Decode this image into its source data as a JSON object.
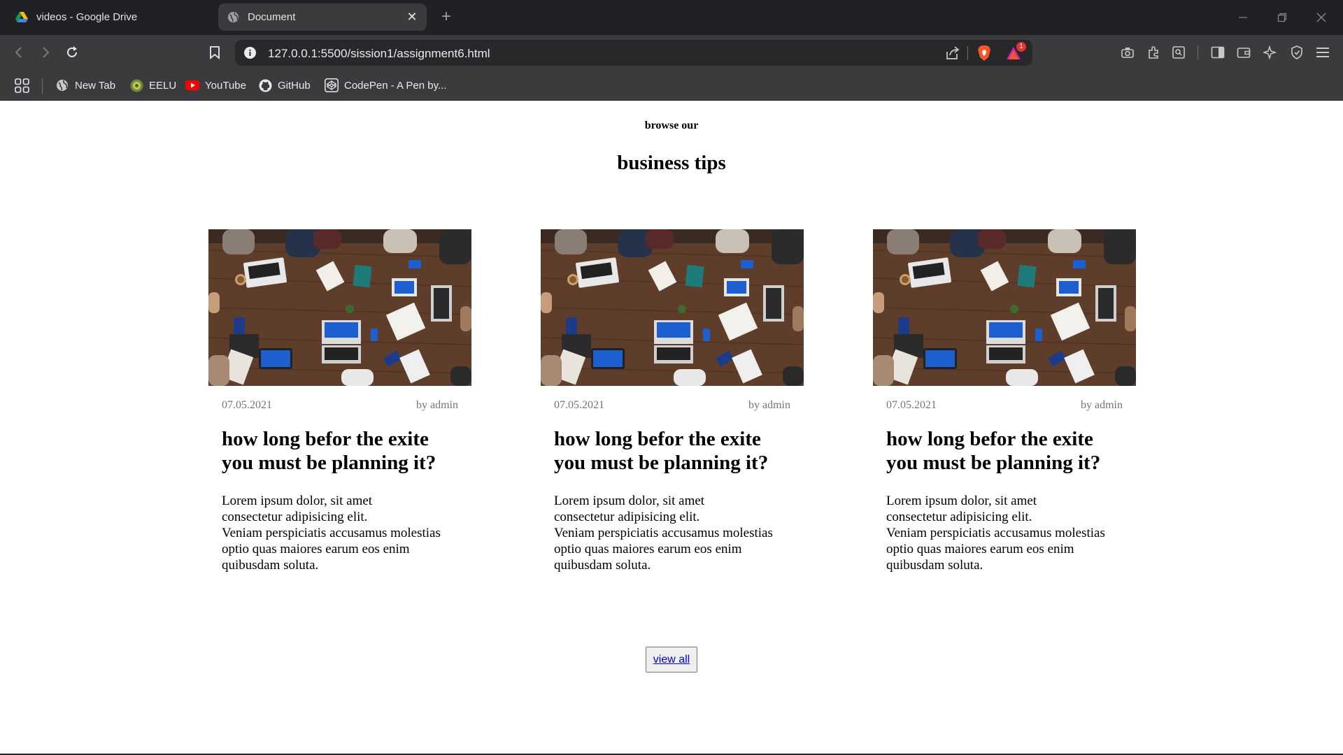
{
  "browser": {
    "tabs": [
      {
        "title": "videos - Google Drive",
        "icon": "google-drive-icon",
        "active": false
      },
      {
        "title": "Document",
        "icon": "globe-icon",
        "active": true
      }
    ],
    "url": "127.0.0.1:5500/sission1/assignment6.html",
    "brave_badge_count": "1",
    "bookmarks": [
      {
        "label": "New Tab",
        "icon": "globe-icon"
      },
      {
        "label": "EELU",
        "icon": "eelu-logo-icon"
      },
      {
        "label": "YouTube",
        "icon": "youtube-icon"
      },
      {
        "label": "GitHub",
        "icon": "github-icon"
      },
      {
        "label": "CodePen - A Pen by...",
        "icon": "codepen-icon"
      }
    ]
  },
  "page": {
    "kicker": "browse our",
    "heading": "business tips",
    "cards": [
      {
        "date": "07.05.2021",
        "author": "by admin",
        "title": "how long befor the exite you must be planning it?",
        "body_lines": [
          "Lorem ipsum dolor, sit amet",
          "consectetur adipisicing elit.",
          "Veniam perspiciatis accusamus molestias",
          "optio quas maiores earum eos enim",
          "quibusdam soluta."
        ]
      },
      {
        "date": "07.05.2021",
        "author": "by admin",
        "title": "how long befor the exite you must be planning it?",
        "body_lines": [
          "Lorem ipsum dolor, sit amet",
          "consectetur adipisicing elit.",
          "Veniam perspiciatis accusamus molestias",
          "optio quas maiores earum eos enim",
          "quibusdam soluta."
        ]
      },
      {
        "date": "07.05.2021",
        "author": "by admin",
        "title": "how long befor the exite you must be planning it?",
        "body_lines": [
          "Lorem ipsum dolor, sit amet",
          "consectetur adipisicing elit.",
          "Veniam perspiciatis accusamus molestias",
          "optio quas maiores earum eos enim",
          "quibusdam soluta."
        ]
      }
    ],
    "view_all_label": "view all"
  },
  "colors": {
    "tabbar_bg": "#202124",
    "toolbar_bg": "#3b3b3e",
    "omnibox_bg": "#28282b",
    "link": "#0000ee",
    "meta_text": "#757575",
    "brave_orange": "#fb542b"
  }
}
